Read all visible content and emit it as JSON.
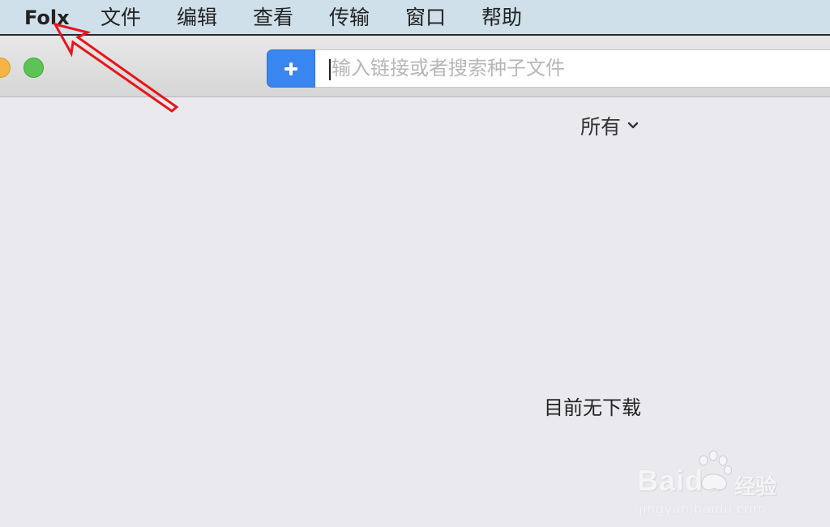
{
  "menubar": {
    "app_name": "Folx",
    "items": [
      {
        "label": "文件"
      },
      {
        "label": "编辑"
      },
      {
        "label": "查看"
      },
      {
        "label": "传输"
      },
      {
        "label": "窗口"
      },
      {
        "label": "帮助"
      }
    ]
  },
  "toolbar": {
    "add_icon": "plus-icon",
    "search_placeholder": "输入链接或者搜索种子文件"
  },
  "filter": {
    "selected": "所有",
    "icon": "chevron-down-icon"
  },
  "main": {
    "empty_message": "目前无下载"
  },
  "watermark": {
    "brand": "Baidu",
    "label": "经验",
    "url": "jingyan.baidu.com"
  },
  "colors": {
    "menubar_bg": "#cfe0ea",
    "accent": "#3a86f0",
    "annotation": "#e8141b"
  }
}
